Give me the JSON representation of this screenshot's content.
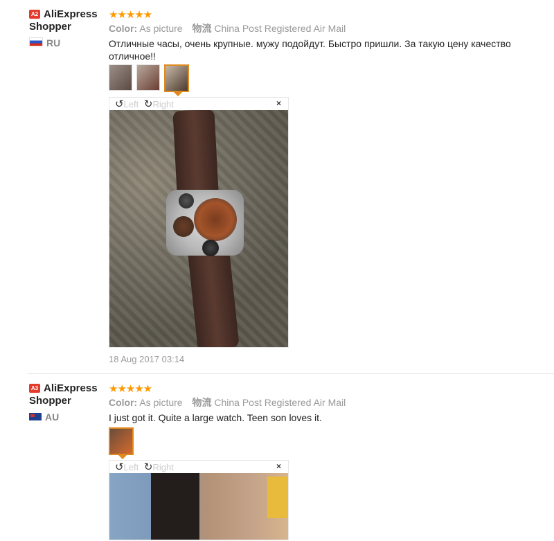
{
  "reviews": [
    {
      "badge": "A2",
      "user_name": "AliExpress Shopper",
      "country": "RU",
      "stars": "★★★★★",
      "color_label": "Color:",
      "color_value": "As picture",
      "logistics_label": "物流",
      "logistics_value": "China Post Registered Air Mail",
      "text": "Отличные часы, очень крупные. мужу подойдут. Быстро пришли. За такую цену качество отличное!!",
      "date": "18 Aug 2017 03:14",
      "viewer": {
        "left": "Left",
        "right": "Right",
        "close": "×"
      }
    },
    {
      "badge": "A3",
      "user_name": "AliExpress Shopper",
      "country": "AU",
      "stars": "★★★★★",
      "color_label": "Color:",
      "color_value": "As picture",
      "logistics_label": "物流",
      "logistics_value": "China Post Registered Air Mail",
      "text": "I just got it. Quite a large watch. Teen son loves it.",
      "viewer": {
        "left": "Left",
        "right": "Right",
        "close": "×"
      }
    }
  ],
  "colors": {
    "star": "#ff9900",
    "badge": "#e43b2c",
    "active_thumb": "#e08a1e"
  },
  "icons": [
    "rotate-left-icon",
    "rotate-right-icon",
    "close-icon",
    "flag-ru-icon",
    "flag-au-icon"
  ]
}
